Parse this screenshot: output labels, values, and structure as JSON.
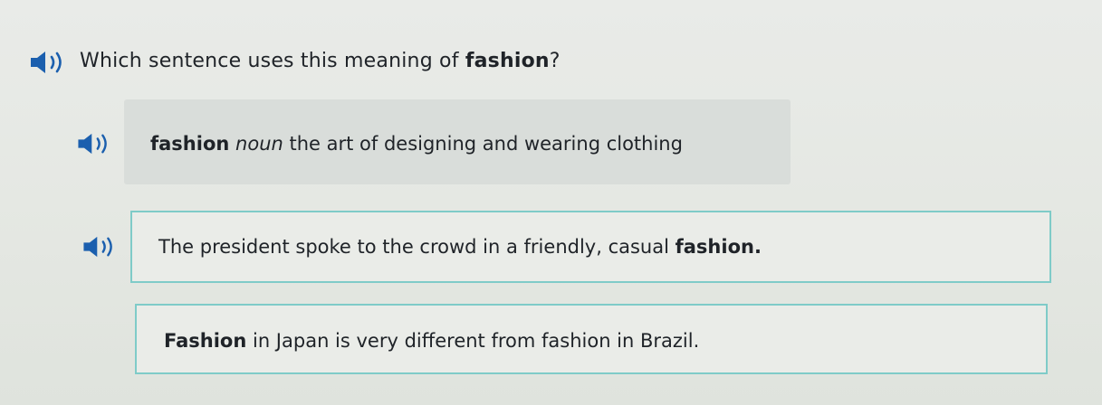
{
  "question": {
    "prefix": "Which sentence uses this meaning of ",
    "word": "fashion",
    "suffix": "?"
  },
  "definition": {
    "word": "fashion",
    "part_of_speech": "noun",
    "meaning": " the art of designing and wearing clothing"
  },
  "choices": [
    {
      "prefix": "The president spoke to the crowd in a friendly, casual ",
      "word": "fashion.",
      "suffix": ""
    },
    {
      "prefix": "",
      "word": "Fashion",
      "suffix": " in Japan is very different from fashion in Brazil."
    }
  ],
  "icons": {
    "audio": "speaker-icon"
  },
  "colors": {
    "speaker": "#1b5fae",
    "choice_border": "#7fcbc8",
    "definition_bg": "#d9ddda"
  }
}
